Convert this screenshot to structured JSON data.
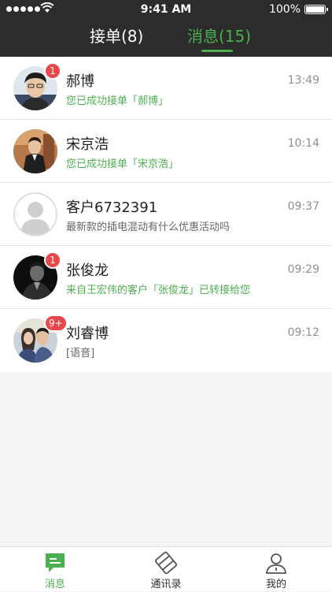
{
  "status_bar": {
    "time": "9:41 AM",
    "battery": "100%"
  },
  "header": {
    "tabs": [
      {
        "label": "接单(8)",
        "active": false
      },
      {
        "label": "消息(15)",
        "active": true
      }
    ]
  },
  "colors": {
    "accent": "#4cb050",
    "badge": "#e8474b",
    "header_bg": "#2c2c2c"
  },
  "messages": [
    {
      "name": "郝博",
      "preview": "您已成功接单「郝博」",
      "time": "13:49",
      "badge": "1",
      "preview_style": "green"
    },
    {
      "name": "宋京浩",
      "preview": "您已成功接单「宋京浩」",
      "time": "10:14",
      "badge": "",
      "preview_style": "green"
    },
    {
      "name": "客户6732391",
      "preview": "最新款的插电混动有什么优惠活动吗",
      "time": "09:37",
      "badge": "",
      "preview_style": "gray"
    },
    {
      "name": "张俊龙",
      "preview": "来自王宏伟的客户「张俊龙」已转接给您",
      "time": "09:29",
      "badge": "1",
      "preview_style": "green"
    },
    {
      "name": "刘睿博",
      "preview": "[语音]",
      "time": "09:12",
      "badge": "9+",
      "preview_style": "gray"
    }
  ],
  "tabbar": {
    "items": [
      {
        "label": "消息",
        "icon": "message-icon",
        "active": true
      },
      {
        "label": "通讯录",
        "icon": "contacts-icon",
        "active": false
      },
      {
        "label": "我的",
        "icon": "person-icon",
        "active": false
      }
    ]
  }
}
